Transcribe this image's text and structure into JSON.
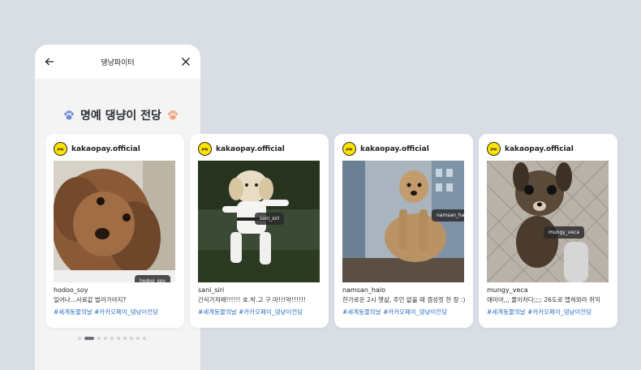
{
  "phone": {
    "title": "댕냥파이터",
    "hall_title": "명예 댕냥이 전당",
    "pagination": {
      "total": 10,
      "active": 1
    }
  },
  "cards": [
    {
      "account": "kakaopay.official",
      "logo_text": "pay",
      "username": "hodoo_soy",
      "text": "일어나...사료값 벌러가야지?",
      "tags": "#세계동물의날 #카카오페이_댕냥이전당",
      "photo_tag": "hodoo_soy"
    },
    {
      "account": "kakaopay.official",
      "logo_text": "pay",
      "username": "sani_siri",
      "text": "간식가져왜!!!!!! 호.박.고 구 마!!!약!!!!!!",
      "tags": "#세계동물의날 #카카오페이_댕냥이전당",
      "photo_tag": "sani_siri"
    },
    {
      "account": "kakaopay.official",
      "logo_text": "pay",
      "username": "namsan_halo",
      "text": "한가로운 2시 햇살, 주인 없을 때 갬성컷 한 장 :)",
      "tags": "#세계동물의날 #카카오페이_댕냥이전당",
      "photo_tag": "namsan_halo"
    },
    {
      "account": "kakaopay.official",
      "logo_text": "pay",
      "username": "mungy_veca",
      "text": "애미야,,, 물이차다;;;; 26도로 맵혀와라 쥐익",
      "tags": "#세계동물의날 #카카오페이_댕냥이전당",
      "photo_tag": "mungy_veca"
    }
  ]
}
